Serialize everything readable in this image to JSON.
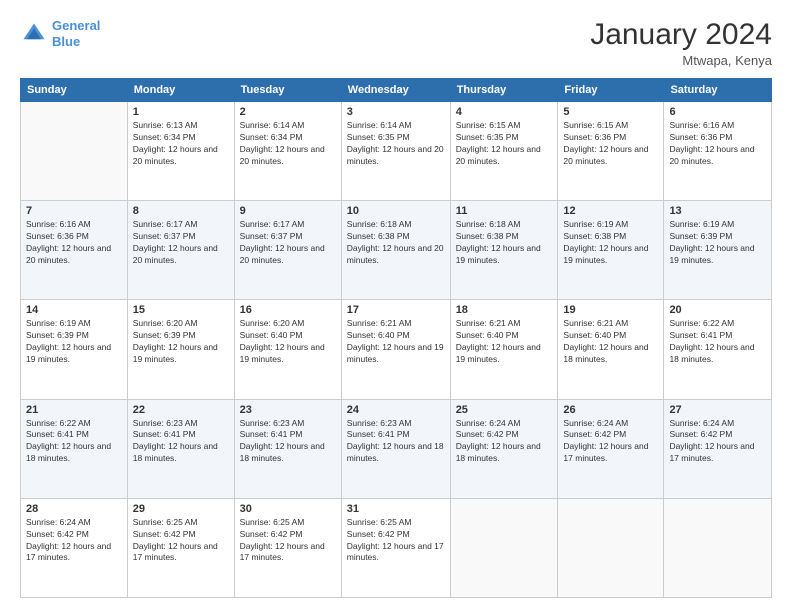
{
  "header": {
    "logo_line1": "General",
    "logo_line2": "Blue",
    "month": "January 2024",
    "location": "Mtwapa, Kenya"
  },
  "weekdays": [
    "Sunday",
    "Monday",
    "Tuesday",
    "Wednesday",
    "Thursday",
    "Friday",
    "Saturday"
  ],
  "weeks": [
    [
      {
        "day": "",
        "empty": true
      },
      {
        "day": "1",
        "sunrise": "6:13 AM",
        "sunset": "6:34 PM",
        "daylight": "12 hours and 20 minutes."
      },
      {
        "day": "2",
        "sunrise": "6:14 AM",
        "sunset": "6:34 PM",
        "daylight": "12 hours and 20 minutes."
      },
      {
        "day": "3",
        "sunrise": "6:14 AM",
        "sunset": "6:35 PM",
        "daylight": "12 hours and 20 minutes."
      },
      {
        "day": "4",
        "sunrise": "6:15 AM",
        "sunset": "6:35 PM",
        "daylight": "12 hours and 20 minutes."
      },
      {
        "day": "5",
        "sunrise": "6:15 AM",
        "sunset": "6:36 PM",
        "daylight": "12 hours and 20 minutes."
      },
      {
        "day": "6",
        "sunrise": "6:16 AM",
        "sunset": "6:36 PM",
        "daylight": "12 hours and 20 minutes."
      }
    ],
    [
      {
        "day": "7",
        "sunrise": "6:16 AM",
        "sunset": "6:36 PM",
        "daylight": "12 hours and 20 minutes."
      },
      {
        "day": "8",
        "sunrise": "6:17 AM",
        "sunset": "6:37 PM",
        "daylight": "12 hours and 20 minutes."
      },
      {
        "day": "9",
        "sunrise": "6:17 AM",
        "sunset": "6:37 PM",
        "daylight": "12 hours and 20 minutes."
      },
      {
        "day": "10",
        "sunrise": "6:18 AM",
        "sunset": "6:38 PM",
        "daylight": "12 hours and 20 minutes."
      },
      {
        "day": "11",
        "sunrise": "6:18 AM",
        "sunset": "6:38 PM",
        "daylight": "12 hours and 19 minutes."
      },
      {
        "day": "12",
        "sunrise": "6:19 AM",
        "sunset": "6:38 PM",
        "daylight": "12 hours and 19 minutes."
      },
      {
        "day": "13",
        "sunrise": "6:19 AM",
        "sunset": "6:39 PM",
        "daylight": "12 hours and 19 minutes."
      }
    ],
    [
      {
        "day": "14",
        "sunrise": "6:19 AM",
        "sunset": "6:39 PM",
        "daylight": "12 hours and 19 minutes."
      },
      {
        "day": "15",
        "sunrise": "6:20 AM",
        "sunset": "6:39 PM",
        "daylight": "12 hours and 19 minutes."
      },
      {
        "day": "16",
        "sunrise": "6:20 AM",
        "sunset": "6:40 PM",
        "daylight": "12 hours and 19 minutes."
      },
      {
        "day": "17",
        "sunrise": "6:21 AM",
        "sunset": "6:40 PM",
        "daylight": "12 hours and 19 minutes."
      },
      {
        "day": "18",
        "sunrise": "6:21 AM",
        "sunset": "6:40 PM",
        "daylight": "12 hours and 19 minutes."
      },
      {
        "day": "19",
        "sunrise": "6:21 AM",
        "sunset": "6:40 PM",
        "daylight": "12 hours and 18 minutes."
      },
      {
        "day": "20",
        "sunrise": "6:22 AM",
        "sunset": "6:41 PM",
        "daylight": "12 hours and 18 minutes."
      }
    ],
    [
      {
        "day": "21",
        "sunrise": "6:22 AM",
        "sunset": "6:41 PM",
        "daylight": "12 hours and 18 minutes."
      },
      {
        "day": "22",
        "sunrise": "6:23 AM",
        "sunset": "6:41 PM",
        "daylight": "12 hours and 18 minutes."
      },
      {
        "day": "23",
        "sunrise": "6:23 AM",
        "sunset": "6:41 PM",
        "daylight": "12 hours and 18 minutes."
      },
      {
        "day": "24",
        "sunrise": "6:23 AM",
        "sunset": "6:41 PM",
        "daylight": "12 hours and 18 minutes."
      },
      {
        "day": "25",
        "sunrise": "6:24 AM",
        "sunset": "6:42 PM",
        "daylight": "12 hours and 18 minutes."
      },
      {
        "day": "26",
        "sunrise": "6:24 AM",
        "sunset": "6:42 PM",
        "daylight": "12 hours and 17 minutes."
      },
      {
        "day": "27",
        "sunrise": "6:24 AM",
        "sunset": "6:42 PM",
        "daylight": "12 hours and 17 minutes."
      }
    ],
    [
      {
        "day": "28",
        "sunrise": "6:24 AM",
        "sunset": "6:42 PM",
        "daylight": "12 hours and 17 minutes."
      },
      {
        "day": "29",
        "sunrise": "6:25 AM",
        "sunset": "6:42 PM",
        "daylight": "12 hours and 17 minutes."
      },
      {
        "day": "30",
        "sunrise": "6:25 AM",
        "sunset": "6:42 PM",
        "daylight": "12 hours and 17 minutes."
      },
      {
        "day": "31",
        "sunrise": "6:25 AM",
        "sunset": "6:42 PM",
        "daylight": "12 hours and 17 minutes."
      },
      {
        "day": "",
        "empty": true
      },
      {
        "day": "",
        "empty": true
      },
      {
        "day": "",
        "empty": true
      }
    ]
  ]
}
